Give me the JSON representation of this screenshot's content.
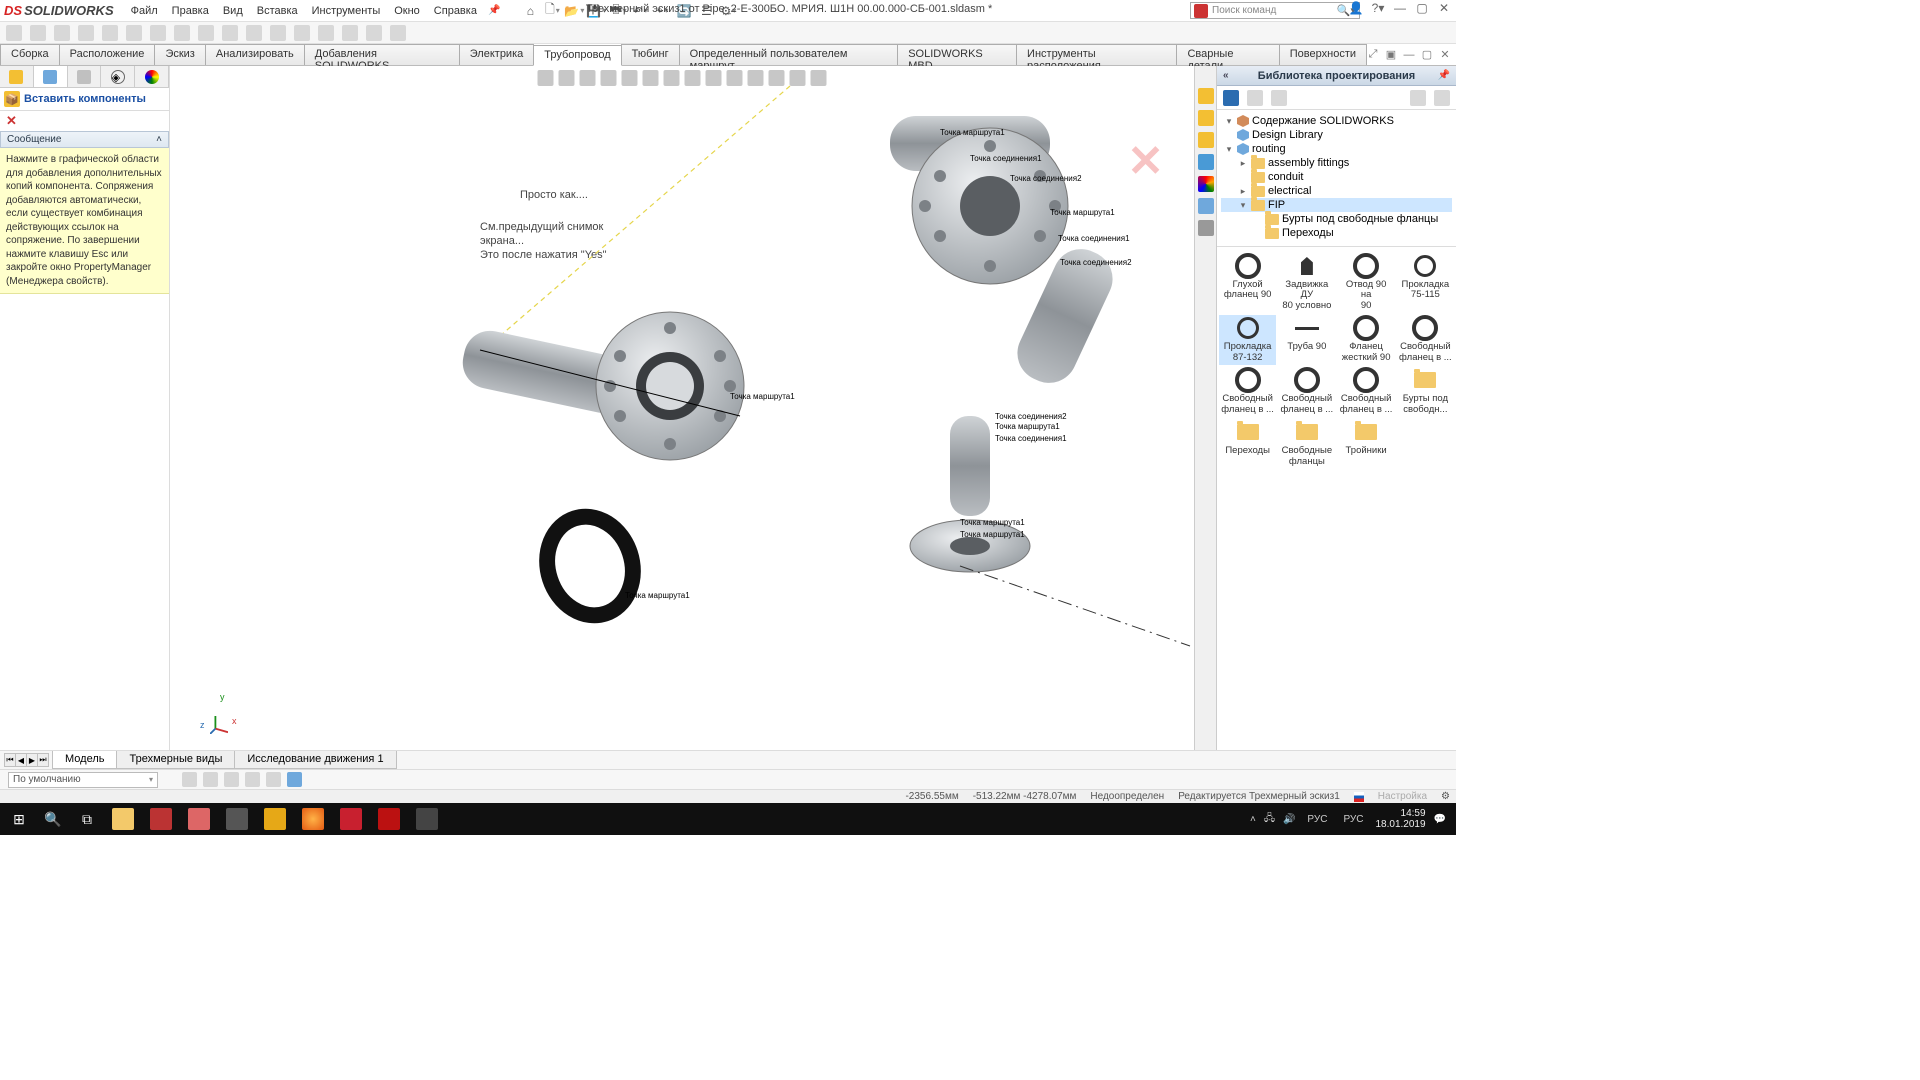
{
  "app": {
    "logo_prefix": "DS",
    "logo_name": "SOLIDWORKS"
  },
  "menu": [
    "Файл",
    "Правка",
    "Вид",
    "Вставка",
    "Инструменты",
    "Окно",
    "Справка"
  ],
  "document_title": "Трехмерный эскиз1 от Pipe_2-Е-300БО. МРИЯ. Ш1Н 00.00.000-СБ-001.sldasm *",
  "search_placeholder": "Поиск команд",
  "ribbon_tabs": [
    "Сборка",
    "Расположение",
    "Эскиз",
    "Анализировать",
    "Добавления SOLIDWORKS",
    "Электрика",
    "Трубопровод",
    "Тюбинг",
    "Определенный пользователем маршрут",
    "SOLIDWORKS MBD",
    "Инструменты расположения",
    "Сварные детали",
    "Поверхности"
  ],
  "ribbon_active": 6,
  "pm": {
    "title": "Вставить компоненты",
    "section": "Сообщение",
    "message": "Нажмите в графической области для добавления дополнительных копий компонента. Сопряжения добавляются автоматически, если существует комбинация действующих ссылок на сопряжение. По завершении нажмите клавишу Esc или закройте окно PropertyManager (Менеджера свойств)."
  },
  "viewport": {
    "note1": "Просто как....",
    "note2a": "См.предыдущий снимок",
    "note2b": "экрана...",
    "note2c": "Это после нажатия \"Yes\"",
    "triad": {
      "x": "x",
      "y": "y",
      "z": "z"
    },
    "annotations": {
      "a1": "Точка маршрута1",
      "a2": "Точка маршрута1",
      "a3": "Точка маршрута1",
      "a4": "Точка соединения1",
      "a5": "Точка соединения2",
      "a6": "Точка маршрута1",
      "a7": "Точка соединения1",
      "a8": "Точка соединения2",
      "a9": "Точка маршрута1",
      "a10": "Точка соединения1",
      "a11": "Точка соединения2",
      "a12": "Точка маршрута1",
      "a13": "Точка маршрута1"
    }
  },
  "library": {
    "title": "Библиотека проектирования",
    "tree": [
      {
        "lvl": 0,
        "tw": "▾",
        "icon": "cube",
        "label": "Содержание SOLIDWORKS"
      },
      {
        "lvl": 0,
        "tw": "",
        "icon": "box",
        "label": "Design Library"
      },
      {
        "lvl": 0,
        "tw": "▾",
        "icon": "box",
        "label": "routing"
      },
      {
        "lvl": 1,
        "tw": "▸",
        "icon": "folder",
        "label": "assembly fittings"
      },
      {
        "lvl": 1,
        "tw": "",
        "icon": "folder",
        "label": "conduit"
      },
      {
        "lvl": 1,
        "tw": "▸",
        "icon": "folder",
        "label": "electrical"
      },
      {
        "lvl": 1,
        "tw": "▾",
        "icon": "folder",
        "label": "FIP",
        "sel": true
      },
      {
        "lvl": 2,
        "tw": "",
        "icon": "folder",
        "label": "Бурты под свободные фланцы"
      },
      {
        "lvl": 2,
        "tw": "",
        "icon": "folder",
        "label": "Переходы"
      }
    ],
    "parts": [
      {
        "t": "flange",
        "l1": "Глухой",
        "l2": "фланец 90"
      },
      {
        "t": "valve",
        "l1": "Задвижка ДУ",
        "l2": "80 условно"
      },
      {
        "t": "flange",
        "l1": "Отвод 90 на",
        "l2": "90"
      },
      {
        "t": "gasket",
        "l1": "Прокладка",
        "l2": "75-115"
      },
      {
        "t": "gasket",
        "l1": "Прокладка",
        "l2": "87-132",
        "sel": true
      },
      {
        "t": "pipe",
        "l1": "Труба 90",
        "l2": ""
      },
      {
        "t": "flange",
        "l1": "Фланец",
        "l2": "жесткий 90"
      },
      {
        "t": "flange",
        "l1": "Свободный",
        "l2": "фланец в ..."
      },
      {
        "t": "flange",
        "l1": "Свободный",
        "l2": "фланец в ..."
      },
      {
        "t": "flange",
        "l1": "Свободный",
        "l2": "фланец в ..."
      },
      {
        "t": "flange",
        "l1": "Свободный",
        "l2": "фланец в ..."
      },
      {
        "t": "folder",
        "l1": "Бурты под",
        "l2": "свободн..."
      },
      {
        "t": "folder",
        "l1": "Переходы",
        "l2": ""
      },
      {
        "t": "folder",
        "l1": "Свободные",
        "l2": "фланцы"
      },
      {
        "t": "folder",
        "l1": "Тройники",
        "l2": ""
      }
    ]
  },
  "bottom_tabs": [
    "Модель",
    "Трехмерные виды",
    "Исследование движения 1"
  ],
  "bottom_active": 0,
  "motion_combo": "По умолчанию",
  "status": {
    "coord_x": "-2356.55мм",
    "coord_yz": "-513.22мм -4278.07мм",
    "defined": "Недоопределен",
    "editing": "Редактируется Трехмерный эскиз1",
    "custom": "Настройка"
  },
  "taskbar": {
    "lang1": "РУС",
    "lang2": "РУС",
    "time": "14:59",
    "date": "18.01.2019"
  }
}
